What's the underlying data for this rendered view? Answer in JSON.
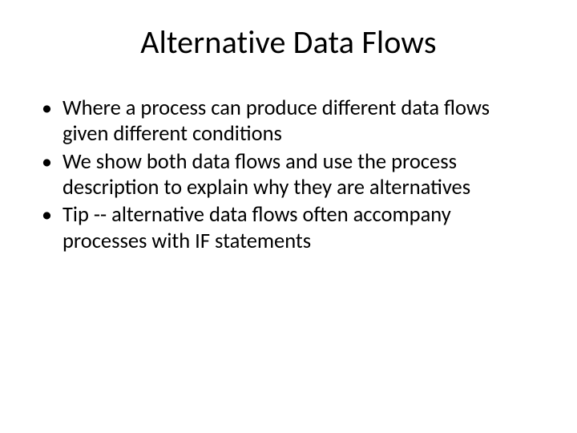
{
  "title": "Alternative Data Flows",
  "bullets": [
    "Where a process can produce different data flows given different conditions",
    "We show both data flows and use the process description to explain why they are alternatives",
    "Tip -- alternative data flows often accompany processes with IF statements"
  ]
}
